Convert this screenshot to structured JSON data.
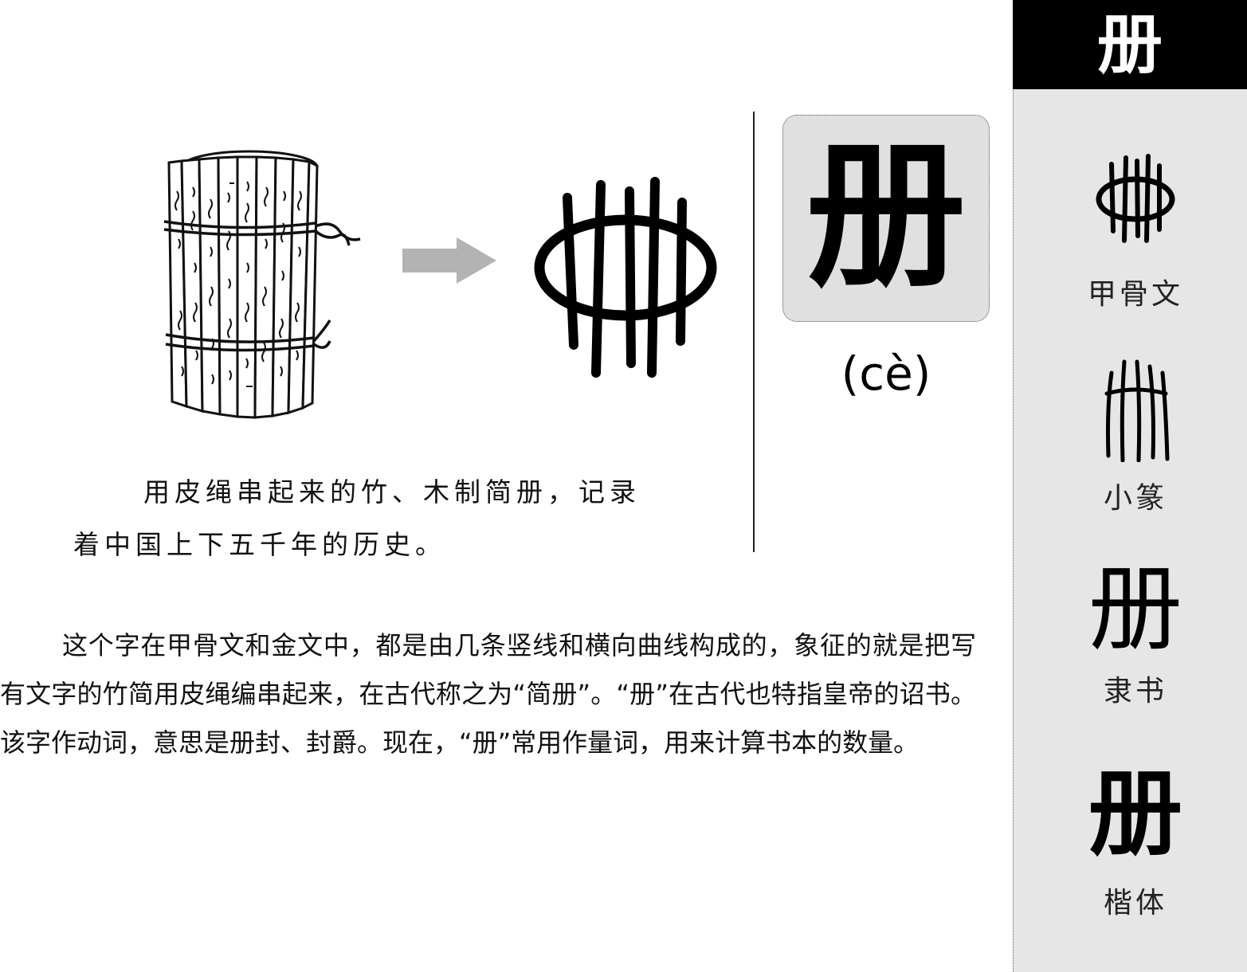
{
  "illustration": {
    "caption_line1": "用皮绳串起来的竹、木制简册，记录",
    "caption_line2": "着中国上下五千年的历史。"
  },
  "character": {
    "glyph": "册",
    "pinyin": "(cè)"
  },
  "description": "这个字在甲骨文和金文中，都是由几条竖线和横向曲线构成的，象征的就是把写有文字的竹简用皮绳编串起来，在古代称之为“简册”。“册”在古代也特指皇帝的诏书。该字作动词，意思是册封、封爵。现在，“册”常用作量词，用来计算书本的数量。",
  "sidebar": {
    "header_glyph": "册",
    "scripts": [
      {
        "label": "甲骨文"
      },
      {
        "label": "小篆"
      },
      {
        "label": "隶书",
        "glyph": "册"
      },
      {
        "label": "楷体",
        "glyph": "册"
      }
    ]
  },
  "colors": {
    "sidebar_bg": "#e6e6e6",
    "header_bg": "#000000",
    "card_bg": "#e0e0e0",
    "arrow": "#b3b3b3"
  }
}
